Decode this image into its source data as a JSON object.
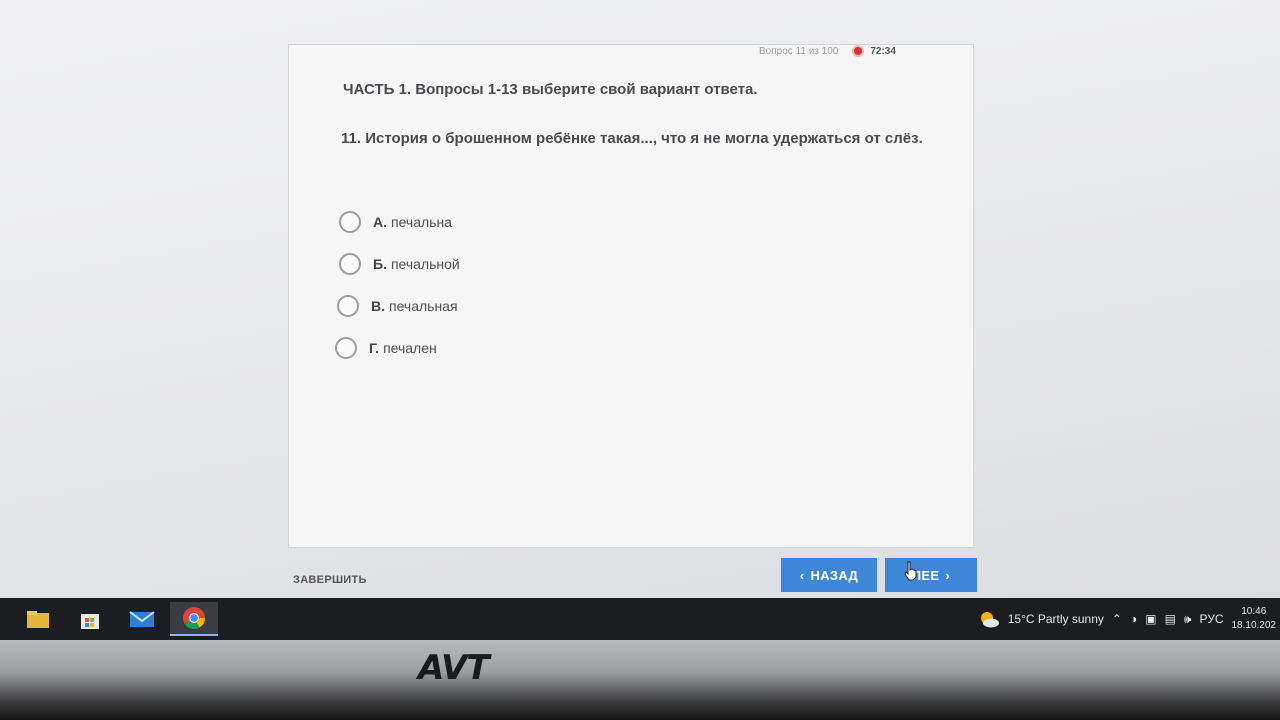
{
  "header": {
    "progress": "Вопрос 11 из 100",
    "timer": "72:34"
  },
  "section_title": "ЧАСТЬ 1. Вопросы 1-13 выберите свой вариант ответа.",
  "question": "11. История о брошенном ребёнке такая..., что я не могла удержаться от слёз.",
  "options": [
    {
      "letter": "А.",
      "text": "печальна"
    },
    {
      "letter": "Б.",
      "text": "печальной"
    },
    {
      "letter": "В.",
      "text": "печальная"
    },
    {
      "letter": "Г.",
      "text": "печален"
    }
  ],
  "footer": {
    "finish_label": "ЗАВЕРШИТЬ",
    "back_label": "НАЗАД",
    "next_label": "ЛЕЕ"
  },
  "taskbar": {
    "apps": [
      "file-explorer-icon",
      "store-icon",
      "mail-icon",
      "chrome-icon"
    ],
    "weather": "15°C  Partly sunny",
    "language": "РУС",
    "time": "10:46",
    "date": "18.10.202"
  },
  "monitor": {
    "brand": "AVT"
  },
  "colors": {
    "accent": "#3d86d8",
    "timer": "#d8312f",
    "taskbar": "#1c1d20"
  }
}
